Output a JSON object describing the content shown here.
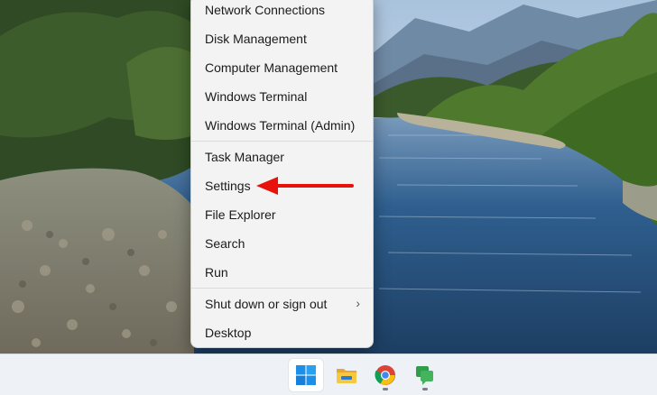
{
  "menu": {
    "items": [
      {
        "label": "Network Connections"
      },
      {
        "label": "Disk Management"
      },
      {
        "label": "Computer Management"
      },
      {
        "label": "Windows Terminal"
      },
      {
        "label": "Windows Terminal (Admin)"
      },
      {
        "label": "Task Manager"
      },
      {
        "label": "Settings"
      },
      {
        "label": "File Explorer"
      },
      {
        "label": "Search"
      },
      {
        "label": "Run"
      },
      {
        "label": "Shut down or sign out",
        "submenu": "›"
      },
      {
        "label": "Desktop"
      }
    ]
  },
  "taskbar": {
    "apps": [
      {
        "icon": "windows-start-icon",
        "active": true
      },
      {
        "icon": "file-explorer-icon"
      },
      {
        "icon": "chrome-icon"
      },
      {
        "icon": "chat-icon"
      }
    ]
  },
  "annotations": {
    "arrow_color": "#e8120c"
  }
}
